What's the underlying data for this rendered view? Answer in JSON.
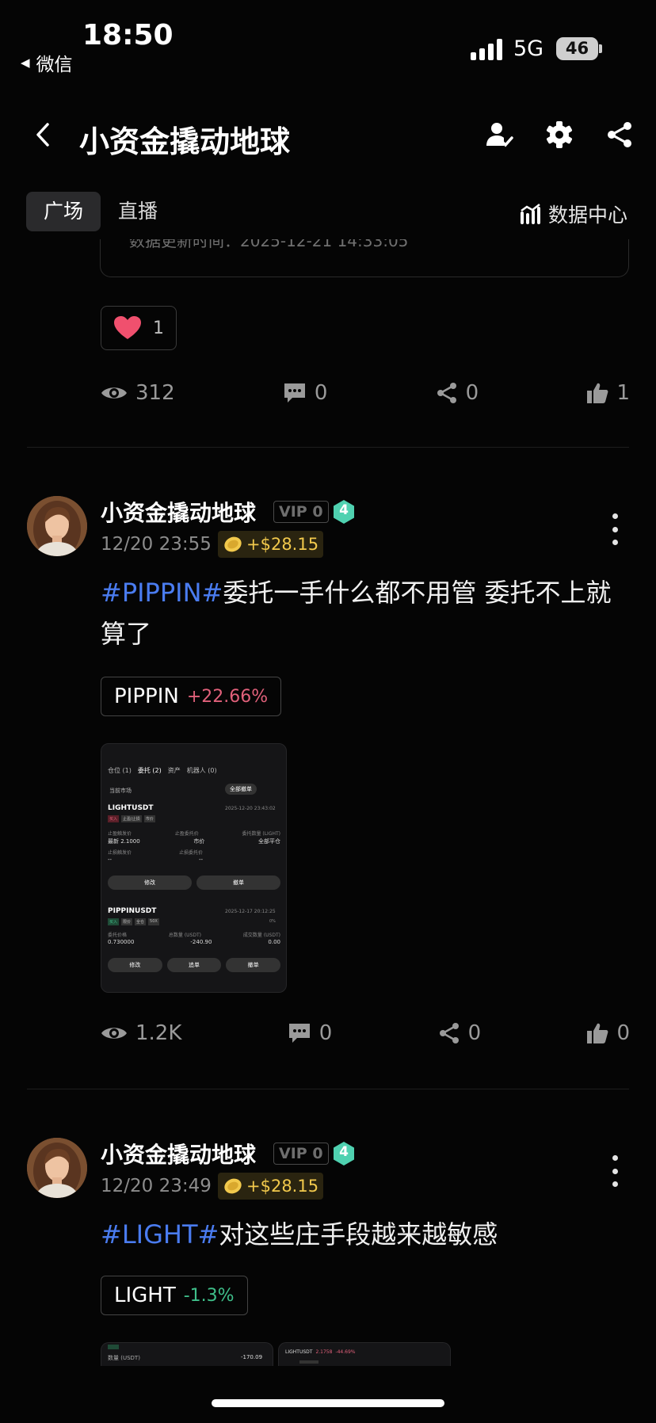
{
  "status_bar": {
    "time": "18:50",
    "back_app": "微信",
    "network": "5G",
    "battery": "46"
  },
  "header": {
    "title": "小资金撬动地球"
  },
  "tabs": [
    {
      "label": "广场"
    },
    {
      "label": "直播"
    }
  ],
  "data_center": {
    "label": "数据中心"
  },
  "partial_post": {
    "update_text": "数据更新时间：2025-12-21 14:33:05",
    "reaction": {
      "emoji": "heart",
      "count": "1"
    },
    "stats": {
      "views": "312",
      "comments": "0",
      "shares": "0",
      "likes": "1"
    }
  },
  "posts": [
    {
      "author": "小资金撬动地球",
      "vip": "VIP 0",
      "level": "4",
      "time": "12/20 23:55",
      "reward": "+$28.15",
      "hashtag": "#PIPPIN#",
      "text": "委托一手什么都不用管 委托不上就算了",
      "ticker": {
        "symbol": "PIPPIN",
        "change": "+22.66%",
        "color": "#e0607a"
      },
      "stats": {
        "views": "1.2K",
        "comments": "0",
        "shares": "0",
        "likes": "0"
      }
    },
    {
      "author": "小资金撬动地球",
      "vip": "VIP 0",
      "level": "4",
      "time": "12/20 23:49",
      "reward": "+$28.15",
      "hashtag": "#LIGHT#",
      "text": "对这些庄手段越来越敏感",
      "ticker": {
        "symbol": "LIGHT",
        "change": "-1.3%",
        "color": "#3fbf8a"
      }
    }
  ],
  "screenshot": {
    "tabs": [
      "仓位 (1)",
      "委托 (2)",
      "资产",
      "机器人 (0)"
    ],
    "current_market": "当前市场",
    "cancel_all": "全部撤单",
    "order1": {
      "symbol": "LIGHTUSDT",
      "time": "2025-12-20 23:43:02",
      "tags": [
        "买入",
        "止盈/止损",
        "市价"
      ],
      "labels": [
        "止盈触发价",
        "止盈委托价",
        "委托数量 (LIGHT)"
      ],
      "values": [
        "最新 2.1000",
        "市价",
        "全部平仓"
      ],
      "labels2": [
        "止损触发价",
        "止损委托价"
      ],
      "values2": [
        "--",
        "--"
      ],
      "buttons": [
        "修改",
        "撤单"
      ]
    },
    "order2": {
      "symbol": "PIPPINUSDT",
      "time": "2025-12-17 20:12:25",
      "tags": [
        "买入",
        "限价",
        "全仓",
        "50X"
      ],
      "progress": "0%",
      "labels": [
        "委托价格",
        "总数量 (USDT)",
        "成交数量 (USDT)"
      ],
      "values": [
        "0.730000",
        "-240.90",
        "0.00"
      ],
      "buttons": [
        "修改",
        "追单",
        "撤单"
      ]
    },
    "third_thumb": {
      "label": "数量 (USDT)",
      "value": "-170.09"
    },
    "fourth_thumb": {
      "symbol": "LIGHTUSDT",
      "price": "2.1758",
      "change": "-44.69%"
    }
  }
}
